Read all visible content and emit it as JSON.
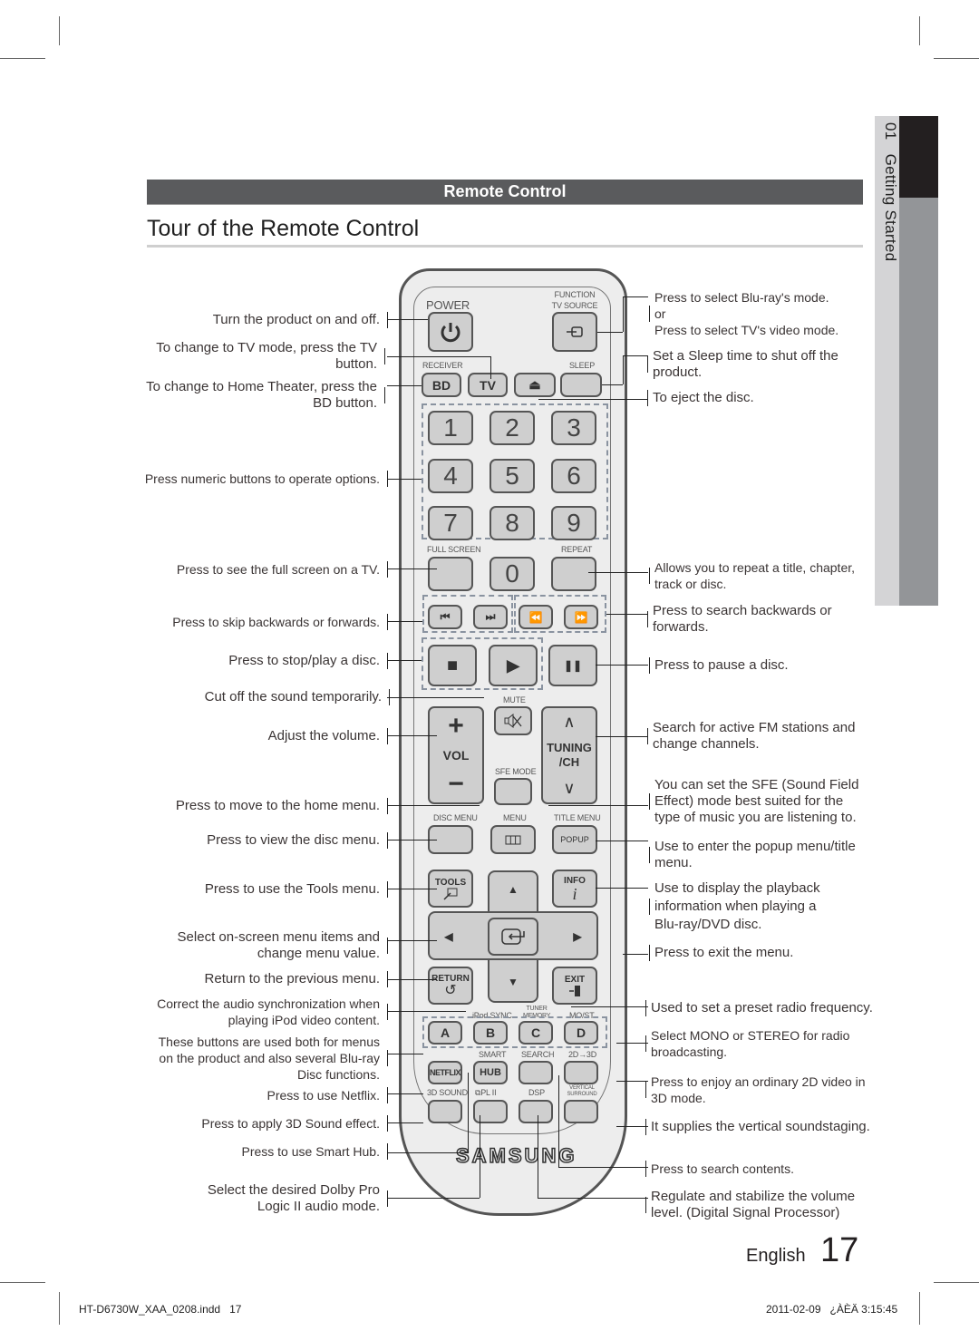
{
  "header": {
    "section": "Remote Control",
    "title": "Tour of the Remote Control"
  },
  "side_tab": {
    "chapter": "01",
    "label": "Getting Started"
  },
  "remote": {
    "brand": "SAMSUNG",
    "labels": {
      "power": "POWER",
      "function_tv_source": "FUNCTION",
      "tv_source": "TV SOURCE",
      "receiver": "RECEIVER",
      "sleep": "SLEEP",
      "full_screen": "FULL SCREEN",
      "repeat": "REPEAT",
      "mute": "MUTE",
      "sfe_mode": "SFE MODE",
      "disc_menu": "DISC MENU",
      "menu": "MENU",
      "title_menu": "TITLE MENU",
      "ipod_sync": "iPod SYNC",
      "tuner_memory": "TUNER MEMORY",
      "mo_st": "MO/ST",
      "smart": "SMART",
      "search": "SEARCH",
      "2d3d": "2D→3D",
      "3d_sound": "3D SOUND",
      "pl2": "⧉PL II",
      "dsp": "DSP",
      "vertical_surround": "VERTICAL SURROUND"
    },
    "buttons": {
      "bd": "BD",
      "tv": "TV",
      "eject": "⏏",
      "digits": [
        "1",
        "2",
        "3",
        "4",
        "5",
        "6",
        "7",
        "8",
        "9",
        "0"
      ],
      "skip_back": "⏮",
      "skip_fwd": "⏭",
      "rewind": "⏪",
      "ffwd": "⏩",
      "stop": "■",
      "play": "▶",
      "pause": "❚❚",
      "vol": "VOL",
      "vol_up": "+",
      "vol_down": "−",
      "tuning": "TUNING",
      "ch": "/CH",
      "ch_up": "∧",
      "ch_down": "∨",
      "popup": "POPUP",
      "tools": "TOOLS",
      "info": "INFO",
      "info_glyph": "i",
      "return": "RETURN",
      "return_glyph": "↺",
      "exit": "EXIT",
      "up": "▲",
      "down": "▼",
      "left": "◀",
      "right": "▶",
      "a": "A",
      "b": "B",
      "c": "C",
      "d": "D",
      "netflix": "NETFLIX",
      "hub": "HUB"
    }
  },
  "notes_left": [
    "Turn the product on and off.",
    "To change to TV mode, press the TV button.",
    "To change to Home Theater, press the BD button.",
    "Press numeric buttons to operate options.",
    "Press to see the full screen on a TV.",
    "Press to skip backwards or forwards.",
    "Press to stop/play a disc.",
    "Cut off the sound temporarily.",
    "Adjust the volume.",
    "Press to move to the home menu.",
    "Press to view the disc menu.",
    "Press to use the Tools menu.",
    "Select on-screen menu items and change menu value.",
    "Return to the previous menu.",
    "Correct the audio synchronization when playing iPod video content.",
    "These buttons are used both for menus on the product and also several Blu-ray Disc functions.",
    "Press to use Netflix.",
    "Press to apply 3D Sound effect.",
    "Press to use Smart Hub.",
    "Select the desired Dolby Pro Logic II audio mode."
  ],
  "notes_right": [
    "Press to select Blu-ray's mode.\nor\nPress to select TV's video mode.",
    "Set a Sleep time to shut off the product.",
    "To eject the disc.",
    "Allows you to repeat a title, chapter, track or disc.",
    "Press to search backwards or forwards.",
    "Press to pause a disc.",
    "Search for active FM stations and change channels.",
    "You can set the SFE (Sound Field Effect) mode best suited for the type of music you are listening to.",
    "Use to enter the popup menu/title menu.",
    "Use to display the playback information when playing a Blu-ray/DVD disc.",
    "Press to exit the menu.",
    "Used to set a preset radio frequency.",
    "Select MONO or STEREO for radio broadcasting.",
    "Press to enjoy an ordinary 2D video in 3D mode.",
    "It supplies the vertical soundstaging.",
    "Press to search contents.",
    "Regulate and stabilize the volume level. (Digital Signal Processor)"
  ],
  "page_footer": {
    "language": "English",
    "page_number": "17"
  },
  "print_footer": {
    "file": "HT-D6730W_XAA_0208.indd   17",
    "timestamp": "2011-02-09   ¿ÀÈÄ 3:15:45"
  }
}
